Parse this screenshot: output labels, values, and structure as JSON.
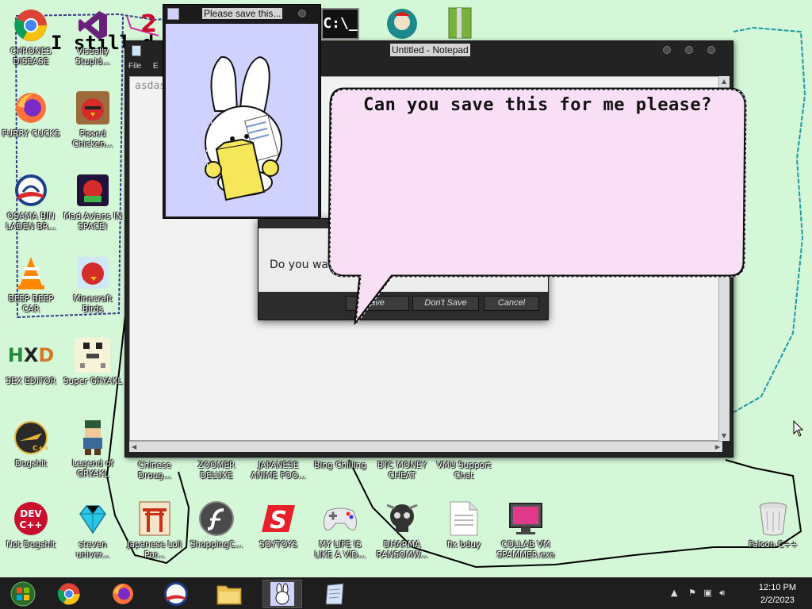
{
  "desktop_scrawl": "I still d",
  "desktop_icons": [
    {
      "label": "CHRONES DISEASE"
    },
    {
      "label": "Visually Stupid..."
    },
    {
      "label": "FURRY CUCKS"
    },
    {
      "label": "Pissed Chicken..."
    },
    {
      "label": "OSAMA BIN LADEN BR..."
    },
    {
      "label": "Mad Avians IN SPACE!"
    },
    {
      "label": "BEEP BEEP CAR"
    },
    {
      "label": "Minecraft Birds"
    },
    {
      "label": "SEX EDITOR"
    },
    {
      "label": "Super GRYAKL"
    },
    {
      "label": "Dogshit"
    },
    {
      "label": "Legend of GRYAKL"
    },
    {
      "label": "Chinese Droug..."
    },
    {
      "label": "ZOOMER DELUXE"
    },
    {
      "label": "JAPANESE ANIME FOO..."
    },
    {
      "label": "Bing Chilling"
    },
    {
      "label": "BTC MONEY CHEAT"
    },
    {
      "label": "VMU Support Chat"
    },
    {
      "label": "Not Dogshit"
    },
    {
      "label": "steven univer..."
    },
    {
      "label": "Japanese Loli Por..."
    },
    {
      "label": "ShoppingC..."
    },
    {
      "label": "SOYTOYS"
    },
    {
      "label": "MY LIFE IS LIKE A VID..."
    },
    {
      "label": "DHARMA RANSOMW..."
    },
    {
      "label": "fix bduy"
    },
    {
      "label": "COLLAB VM SPAMMER.exe"
    },
    {
      "label": "Falcon C++"
    }
  ],
  "notepad": {
    "title": "Untitled - Notepad",
    "menu": [
      "File",
      "E"
    ],
    "content": "asdas"
  },
  "dialog": {
    "message": "Do you wa",
    "buttons": [
      "ave",
      "Don't Save",
      "Cancel"
    ]
  },
  "bubble_text": "Can you save this for me please?",
  "popup": {
    "title": "Please save this..."
  },
  "taskbar": {
    "time": "12:10 PM",
    "date": "2/2/2023"
  },
  "colors": {
    "desktop_bg": "#d4f7d8",
    "bubble_fill": "#f9dff5",
    "popup_bg": "#cfd2ff",
    "taskbar_bg": "#1e1e1e",
    "folder_yellow": "#f5e65a"
  }
}
